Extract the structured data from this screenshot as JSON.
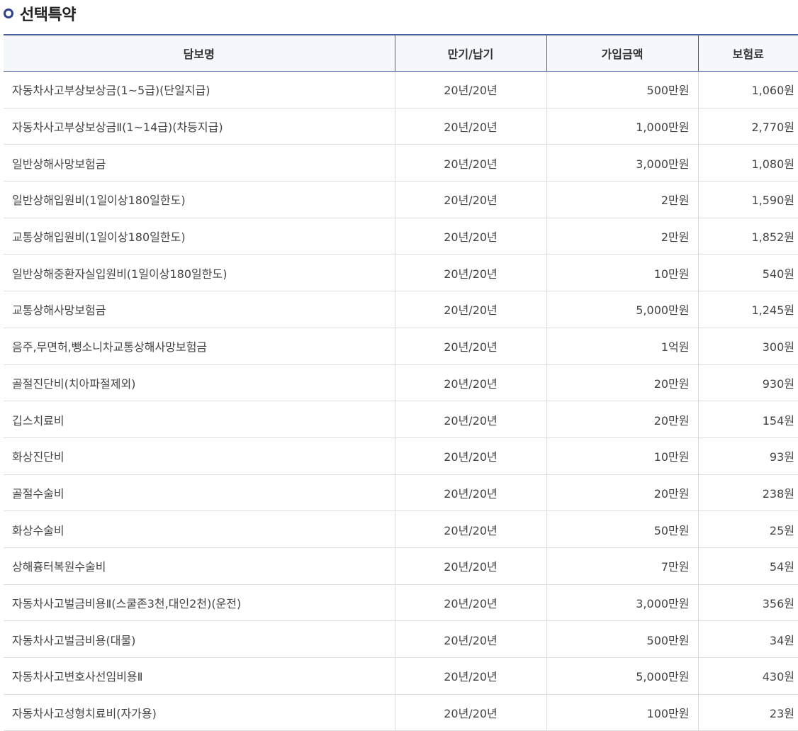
{
  "page": {
    "title": "선택특약",
    "accent_color": "#2e3f8f",
    "bullet_icon": "ring-bullet-icon"
  },
  "table": {
    "columns": [
      "담보명",
      "만기/납기",
      "가입금액",
      "보험료"
    ],
    "rows": [
      {
        "name": "자동차사고부상보상금(1~5급)(단일지급)",
        "term": "20년/20년",
        "amount": "500만원",
        "premium": "1,060원"
      },
      {
        "name": "자동차사고부상보상금Ⅱ(1~14급)(차등지급)",
        "term": "20년/20년",
        "amount": "1,000만원",
        "premium": "2,770원"
      },
      {
        "name": "일반상해사망보험금",
        "term": "20년/20년",
        "amount": "3,000만원",
        "premium": "1,080원"
      },
      {
        "name": "일반상해입원비(1일이상180일한도)",
        "term": "20년/20년",
        "amount": "2만원",
        "premium": "1,590원"
      },
      {
        "name": "교통상해입원비(1일이상180일한도)",
        "term": "20년/20년",
        "amount": "2만원",
        "premium": "1,852원"
      },
      {
        "name": "일반상해중환자실입원비(1일이상180일한도)",
        "term": "20년/20년",
        "amount": "10만원",
        "premium": "540원"
      },
      {
        "name": "교통상해사망보험금",
        "term": "20년/20년",
        "amount": "5,000만원",
        "premium": "1,245원"
      },
      {
        "name": "음주,무면허,뺑소니차교통상해사망보험금",
        "term": "20년/20년",
        "amount": "1억원",
        "premium": "300원"
      },
      {
        "name": "골절진단비(치아파절제외)",
        "term": "20년/20년",
        "amount": "20만원",
        "premium": "930원"
      },
      {
        "name": "깁스치료비",
        "term": "20년/20년",
        "amount": "20만원",
        "premium": "154원"
      },
      {
        "name": "화상진단비",
        "term": "20년/20년",
        "amount": "10만원",
        "premium": "93원"
      },
      {
        "name": "골절수술비",
        "term": "20년/20년",
        "amount": "20만원",
        "premium": "238원"
      },
      {
        "name": "화상수술비",
        "term": "20년/20년",
        "amount": "50만원",
        "premium": "25원"
      },
      {
        "name": "상해흉터복원수술비",
        "term": "20년/20년",
        "amount": "7만원",
        "premium": "54원"
      },
      {
        "name": "자동차사고벌금비용Ⅱ(스쿨존3천,대인2천)(운전)",
        "term": "20년/20년",
        "amount": "3,000만원",
        "premium": "356원"
      },
      {
        "name": "자동차사고벌금비용(대물)",
        "term": "20년/20년",
        "amount": "500만원",
        "premium": "34원"
      },
      {
        "name": "자동차사고변호사선임비용Ⅱ",
        "term": "20년/20년",
        "amount": "5,000만원",
        "premium": "430원"
      },
      {
        "name": "자동차사고성형치료비(자가용)",
        "term": "20년/20년",
        "amount": "100만원",
        "premium": "23원"
      }
    ]
  }
}
